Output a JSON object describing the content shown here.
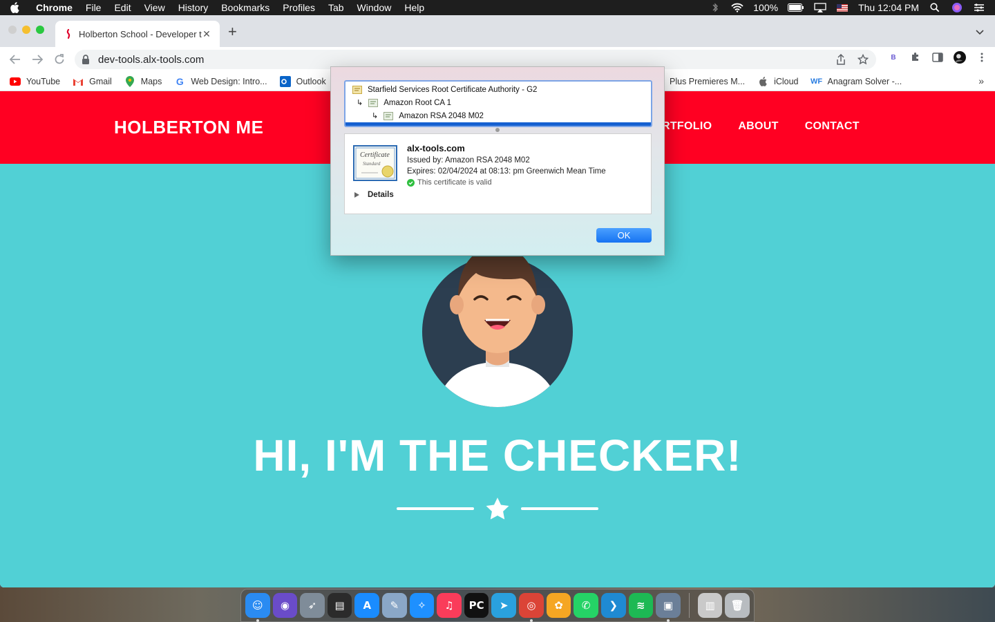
{
  "menubar": {
    "app_name": "Chrome",
    "items": [
      "File",
      "Edit",
      "View",
      "History",
      "Bookmarks",
      "Profiles",
      "Tab",
      "Window",
      "Help"
    ],
    "battery": "100%",
    "clock": "Thu 12:04 PM"
  },
  "tab": {
    "title": "Holberton School - Developer t",
    "favicon_color": "#e0002a"
  },
  "address_bar": {
    "url": "dev-tools.alx-tools.com"
  },
  "bookmarks": {
    "left": [
      {
        "label": "YouTube",
        "icon": "youtube-icon"
      },
      {
        "label": "Gmail",
        "icon": "gmail-icon"
      },
      {
        "label": "Maps",
        "icon": "maps-icon"
      },
      {
        "label": "Web Design: Intro...",
        "icon": "google-icon"
      },
      {
        "label": "Outlook",
        "icon": "outlook-icon"
      }
    ],
    "right": [
      {
        "label": "Plus Premieres M...",
        "icon": "bookmark-icon"
      },
      {
        "label": "iCloud",
        "icon": "apple-icon"
      },
      {
        "label": "Anagram Solver -...",
        "icon": "wf-icon"
      }
    ],
    "overflow": "»"
  },
  "site": {
    "brand": "HOLBERTON ME",
    "nav": [
      "RTFOLIO",
      "ABOUT",
      "CONTACT"
    ],
    "hero_title": "HI, I'M THE CHECKER!",
    "header_color": "#ff0022",
    "background_color": "#51d0d5"
  },
  "dialog": {
    "chain": [
      "Starfield Services Root Certificate Authority - G2",
      "Amazon Root CA 1",
      "Amazon RSA 2048 M02"
    ],
    "cert_image_title": "Certificate",
    "cert_image_subtitle": "Standard",
    "domain": "alx-tools.com",
    "issued_by": "Issued by: Amazon RSA 2048 M02",
    "expires": "Expires: 02/04/2024 at 08:13: pm Greenwich Mean Time",
    "validity": "This certificate is valid",
    "details_label": "Details",
    "ok_label": "OK"
  },
  "dock": {
    "apps": [
      {
        "name": "finder-icon",
        "color": "#2a8bf2",
        "glyph": "☺"
      },
      {
        "name": "siri-icon",
        "color": "#6a4cc9",
        "glyph": "◉"
      },
      {
        "name": "launchpad-icon",
        "color": "#7f8c99",
        "glyph": "➶"
      },
      {
        "name": "activity-monitor-icon",
        "color": "#2b2b2b",
        "glyph": "▤"
      },
      {
        "name": "app-store-icon",
        "color": "#1a8cff",
        "glyph": "A"
      },
      {
        "name": "preview-icon",
        "color": "#8aa7c7",
        "glyph": "✎"
      },
      {
        "name": "safari-icon",
        "color": "#1e90ff",
        "glyph": "✧"
      },
      {
        "name": "music-icon",
        "color": "#fa3c5a",
        "glyph": "♫"
      },
      {
        "name": "pycharm-icon",
        "color": "#111111",
        "glyph": "PC"
      },
      {
        "name": "telegram-icon",
        "color": "#2aa1de",
        "glyph": "➤"
      },
      {
        "name": "chrome-icon",
        "color": "#db4437",
        "glyph": "◎"
      },
      {
        "name": "photos-icon",
        "color": "#f5a623",
        "glyph": "✿"
      },
      {
        "name": "whatsapp-icon",
        "color": "#25d366",
        "glyph": "✆"
      },
      {
        "name": "vscode-icon",
        "color": "#1f8ad2",
        "glyph": "❯"
      },
      {
        "name": "spotify-icon",
        "color": "#1db954",
        "glyph": "≋"
      },
      {
        "name": "image-capture-icon",
        "color": "#6b7f98",
        "glyph": "▣"
      }
    ],
    "extras": [
      {
        "name": "downloads-stack-icon",
        "color": "#c9c9c9",
        "glyph": "▥"
      },
      {
        "name": "trash-icon",
        "color": "#b8bcc0",
        "glyph": "🗑"
      }
    ]
  }
}
